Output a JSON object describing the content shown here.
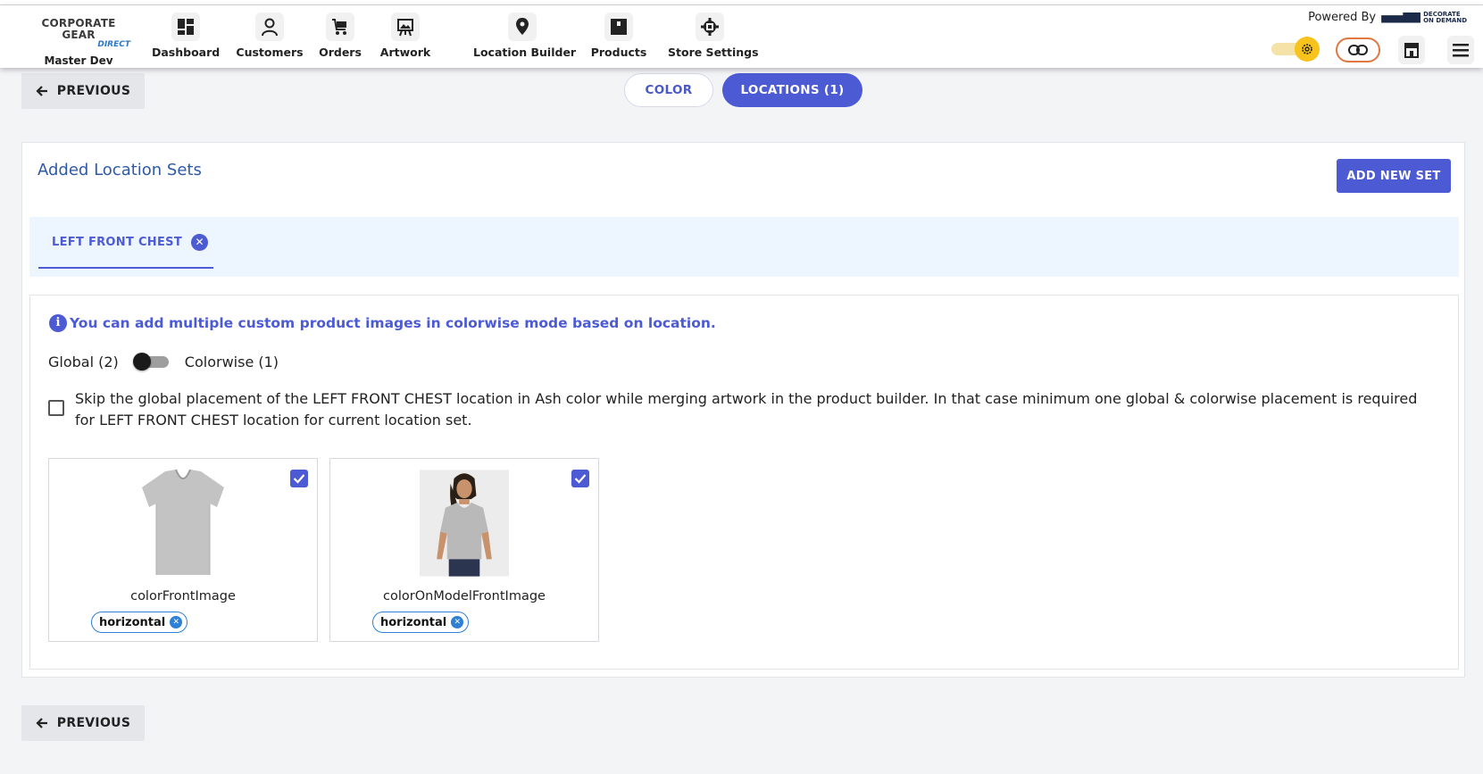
{
  "header": {
    "brand_logo": "CORPORATE GEAR",
    "brand_sub": "DIRECT",
    "brand_store": "Master Dev",
    "nav": [
      {
        "label": "Dashboard",
        "icon": "dashboard-icon"
      },
      {
        "label": "Customers",
        "icon": "customer-icon"
      },
      {
        "label": "Orders",
        "icon": "orders-icon"
      },
      {
        "label": "Artwork",
        "icon": "artwork-icon"
      },
      {
        "label": "Location Builder",
        "icon": "location-pin-icon"
      },
      {
        "label": "Products",
        "icon": "products-box-icon"
      },
      {
        "label": "Store Settings",
        "icon": "store-settings-icon"
      }
    ],
    "powered_by": "Powered By",
    "dod_logo_line1": "DECORATE",
    "dod_logo_line2": "ON DEMAND"
  },
  "tabs": {
    "color": "COLOR",
    "locations": "LOCATIONS (1)",
    "active": "locations"
  },
  "previous_label": "PREVIOUS",
  "section": {
    "title": "Added Location Sets",
    "add_button": "ADD NEW SET",
    "location_tab": "LEFT FRONT CHEST",
    "info": "You can add multiple custom product images in colorwise mode based on location.",
    "mode_global": "Global (2)",
    "mode_colorwise": "Colorwise (1)",
    "mode_colorwise_on": false,
    "skip_checked": false,
    "skip_text": "Skip the global placement of the LEFT FRONT CHEST location in Ash color while merging artwork in the product builder. In that case minimum one global & colorwise placement is required for LEFT FRONT CHEST location for current location set."
  },
  "images": [
    {
      "name": "colorFrontImage",
      "orientation": "horizontal",
      "checked": true,
      "thumb": "gray-tshirt"
    },
    {
      "name": "colorOnModelFrontImage",
      "orientation": "horizontal",
      "checked": true,
      "thumb": "model-in-gray-tshirt"
    }
  ],
  "colors": {
    "accent": "#4c5bd3",
    "title_blue": "#2e5aa8",
    "toggle_yellow": "#f7c31c",
    "link_orange": "#e07840"
  }
}
